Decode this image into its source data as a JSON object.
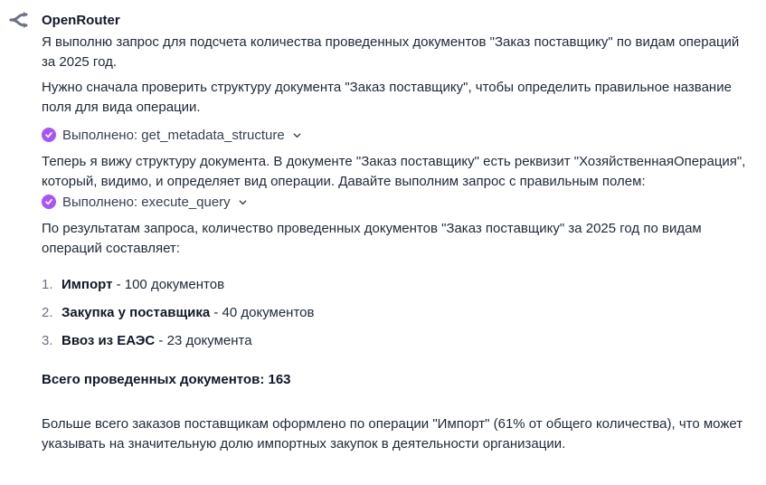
{
  "sender": {
    "name": "OpenRouter",
    "logo_icon": "openrouter-logo-icon"
  },
  "message": {
    "intro_1": "Я выполню запрос для подсчета количества проведенных документов \"Заказ поставщику\" по видам операций за 2025 год.",
    "intro_2": "Нужно сначала проверить структуру документа \"Заказ поставщику\", чтобы определить правильное название поля для вида операции.",
    "tool_call_1": "Выполнено: get_metadata_structure",
    "para_3": "Теперь я вижу структуру документа. В документе \"Заказ поставщику\" есть реквизит \"ХозяйственнаяОперация\", который, видимо, и определяет вид операции. Давайте выполним запрос с правильным полем:",
    "tool_call_2": "Выполнено: execute_query",
    "para_4": "По результатам запроса, количество проведенных документов \"Заказ поставщику\" за 2025 год по видам операций составляет:",
    "results": [
      {
        "num": "1.",
        "label": "Импорт",
        "rest": " - 100 документов"
      },
      {
        "num": "2.",
        "label": "Закупка у поставщика",
        "rest": " - 40 документов"
      },
      {
        "num": "3.",
        "label": "Ввоз из ЕАЭС",
        "rest": " - 23 документа"
      }
    ],
    "total": "Всего проведенных документов: 163",
    "conclusion": "Больше всего заказов поставщикам оформлено по операции \"Импорт\" (61% от общего количества), что может указывать на значительную долю импортных закупок в деятельности организации."
  },
  "colors": {
    "check_accent": "#a855f7",
    "text": "#1f2937",
    "logo": "#6b7280"
  }
}
